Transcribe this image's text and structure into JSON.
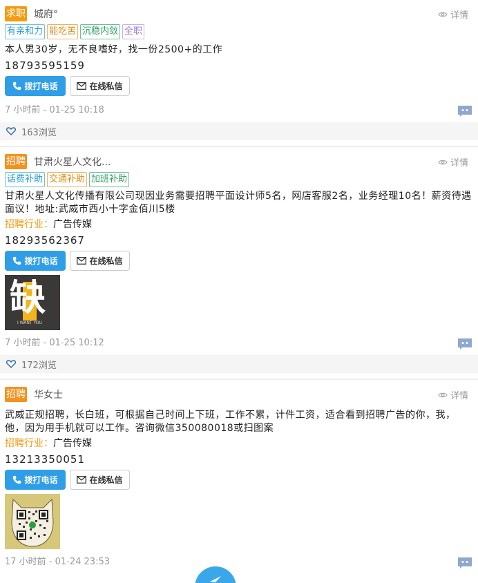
{
  "common": {
    "detail_label": "详情",
    "call_label": "拨打电话",
    "message_label": "在线私信",
    "industry_key": "招聘行业："
  },
  "posts": [
    {
      "badge": "求职",
      "poster": "城府°",
      "tags": [
        "有亲和力",
        "能吃苦",
        "沉稳内敛",
        "全职"
      ],
      "description": "本人男30岁，无不良嗜好，找一份2500+的工作",
      "phone": "18793595159",
      "time": "7 小时前 - 01-25 10:18",
      "views": "163浏览"
    },
    {
      "badge": "招聘",
      "poster": "甘肃火星人文化...",
      "tags": [
        "话费补助",
        "交通补助",
        "加班补助"
      ],
      "description": "甘肃火星人文化传播有限公司现因业务需要招聘平面设计师5名，网店客服2名，业务经理10名！薪资待遇面议！地址:武威市西小十字金佰川5楼",
      "industry": "广告传媒",
      "phone": "18293562367",
      "image_text": {
        "big": "缺",
        "small": "I WANT YOU"
      },
      "time": "7 小时前 - 01-25 10:12",
      "views": "172浏览"
    },
    {
      "badge": "招聘",
      "poster": "华女士",
      "description": "武威正规招聘，长白班，可根据自己时间上下班，工作不累，计件工资，适合看到招聘广告的你，我，他，因为用手机就可以工作。咨询微信350080018或扫图案",
      "industry": "广告传媒",
      "phone": "13213350051",
      "time": "17 小时前 - 01-24 23:53"
    }
  ],
  "colors": {
    "badge": "#f39c12",
    "call_button": "#2f9ee6",
    "comment_icon": "#8fa8cc",
    "fab": "#3aa7ea"
  }
}
